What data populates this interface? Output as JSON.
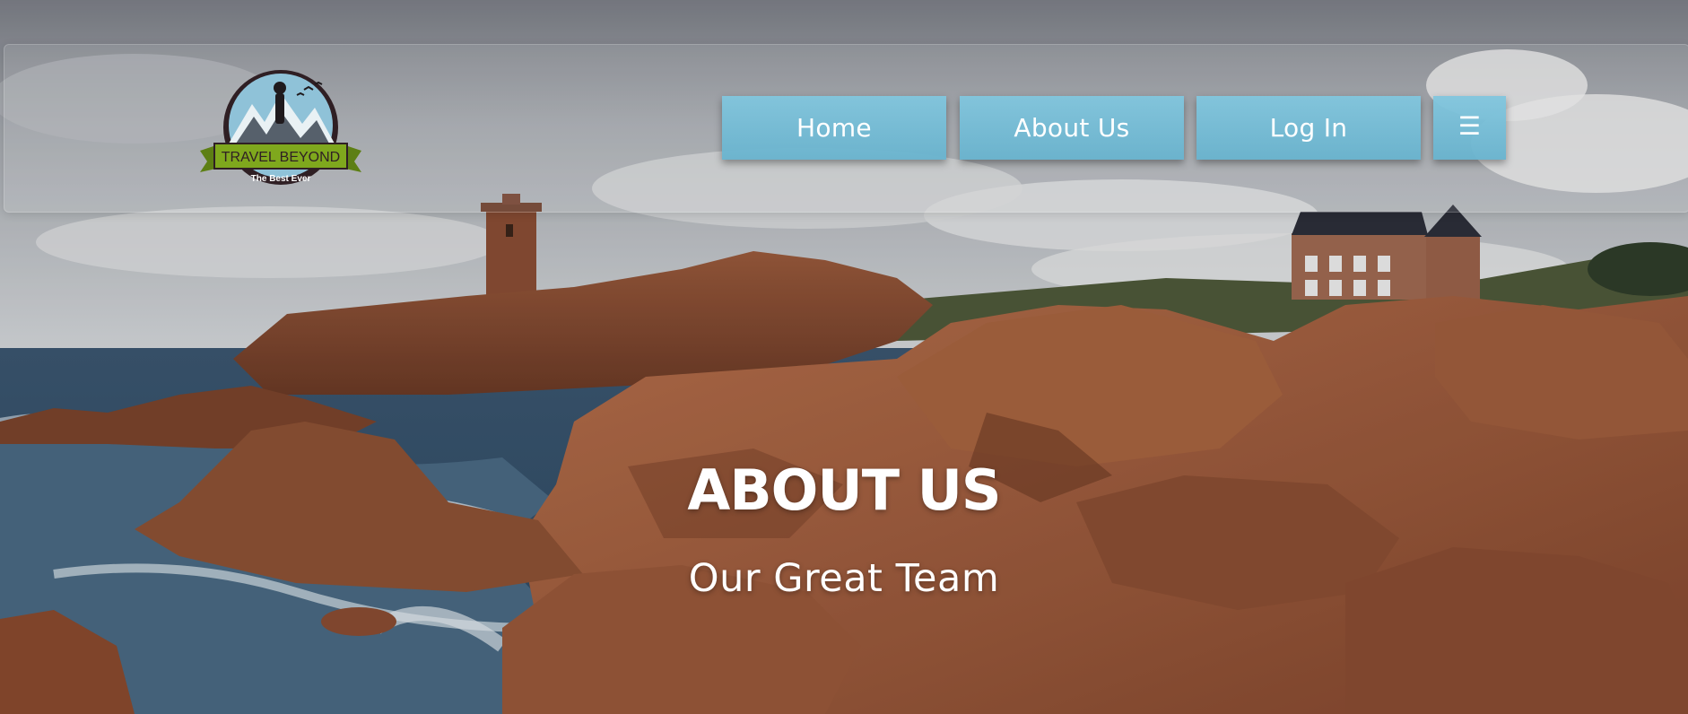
{
  "logo": {
    "brand": "TRAVEL BEYOND",
    "tagline": "The Best Ever"
  },
  "nav": {
    "home": "Home",
    "about": "About Us",
    "login": "Log In",
    "menu_icon": "hamburger-menu-icon"
  },
  "hero": {
    "title": "ABOUT US",
    "subtitle": "Our Great Team"
  },
  "colors": {
    "nav_button": "#78bed8",
    "text": "#ffffff",
    "logo_green": "#7fa81d",
    "logo_dark": "#2f1f24"
  }
}
